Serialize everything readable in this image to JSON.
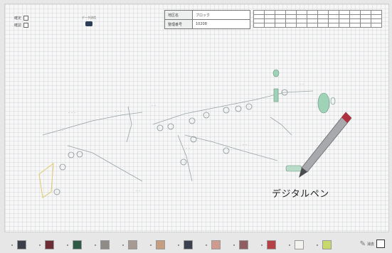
{
  "caption": "デジタルペン",
  "header": {
    "labels": [
      "確定",
      "確認"
    ],
    "icon": "tablet-icon",
    "icon_caption": "データ送信"
  },
  "info_table": [
    {
      "key": "地区名",
      "value": "ブロック"
    },
    {
      "key": "整理番号",
      "value": "10208"
    }
  ],
  "palette": {
    "colors": [
      "#3a3f48",
      "#6b2e35",
      "#2f5a45",
      "#8f8b86",
      "#a59b94",
      "#c59d80",
      "#3c4152",
      "#cf9b8e",
      "#8e5e63",
      "#b54046",
      "#f4f2ee",
      "#c8d86b"
    ]
  },
  "tools": {
    "label": "消去",
    "icons": [
      "pen-icon",
      "square-icon"
    ]
  },
  "accent": "#b13040"
}
